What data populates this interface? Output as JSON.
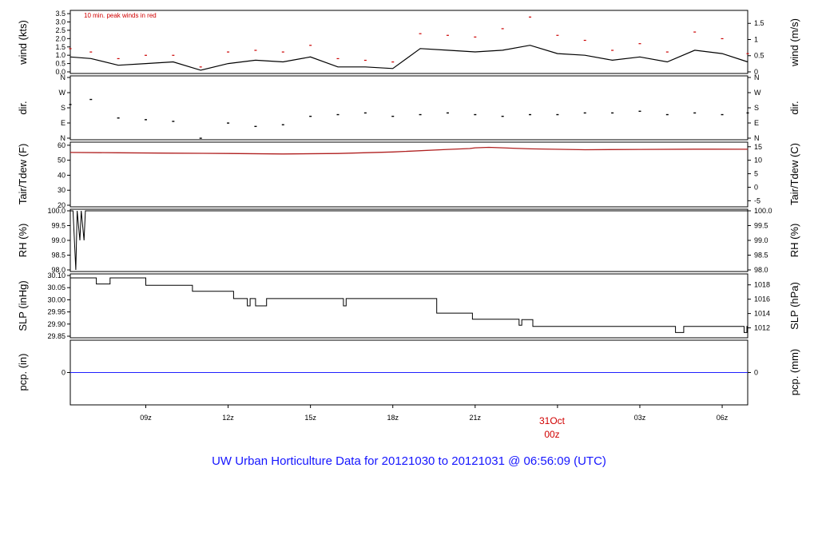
{
  "title": "UW Urban Horticulture Data for 20121030  to  20121031 @ 06:56:09  (UTC)",
  "date_marker": {
    "day": "31Oct",
    "hour": "00z"
  },
  "x_ticks": [
    "09z",
    "12z",
    "15z",
    "18z",
    "21z",
    "03z",
    "06z"
  ],
  "colors": {
    "line": "#000000",
    "peak": "#cc0000",
    "temperature": "#b02020",
    "precip": "#2020ff",
    "title": "#1515ff",
    "date": "#d00000"
  },
  "chart_data": [
    {
      "type": "line",
      "ylabel_left": "wind (kts)",
      "ylabel_right": "wind (m/s)",
      "annotation": "10 min. peak winds in red",
      "ylim": [
        0,
        3.6
      ],
      "left_ticks": [
        "0.0",
        "0.5",
        "1.0",
        "1.5",
        "2.0",
        "2.5",
        "3.0",
        "3.5"
      ],
      "right_ticks": [
        "0",
        "0.5",
        "1",
        "1.5"
      ],
      "x_hours": [
        6.25,
        7,
        8,
        9,
        10,
        11,
        12,
        13,
        14,
        15,
        16,
        17,
        18,
        19,
        20,
        21,
        22,
        23,
        24,
        25,
        26,
        27,
        28,
        29,
        30,
        30.93
      ],
      "speed": [
        0.9,
        0.8,
        0.4,
        0.5,
        0.6,
        0.1,
        0.5,
        0.7,
        0.6,
        0.9,
        0.3,
        0.3,
        0.2,
        1.4,
        1.3,
        1.2,
        1.3,
        1.6,
        1.1,
        1.0,
        0.7,
        0.9,
        0.6,
        1.3,
        1.1,
        0.6
      ],
      "peak": [
        1.4,
        1.2,
        0.8,
        1.0,
        1.0,
        0.3,
        1.2,
        1.3,
        1.2,
        1.6,
        0.8,
        0.7,
        0.6,
        2.3,
        2.2,
        2.1,
        2.6,
        3.3,
        2.2,
        1.9,
        1.3,
        1.7,
        1.2,
        2.4,
        2.0,
        1.1
      ]
    },
    {
      "type": "scatter",
      "ylabel_left": "dir.",
      "ylabel_right": "dir.",
      "compass_ticks": [
        "N",
        "E",
        "S",
        "W",
        "N"
      ],
      "ylim": [
        0,
        360
      ],
      "x_hours": [
        6.25,
        7,
        8,
        9,
        10,
        11,
        12,
        13,
        14,
        15,
        16,
        17,
        18,
        19,
        20,
        21,
        22,
        23,
        24,
        25,
        26,
        27,
        28,
        29,
        30,
        30.93
      ],
      "direction_deg": [
        200,
        230,
        120,
        110,
        100,
        0,
        90,
        70,
        80,
        130,
        140,
        150,
        130,
        140,
        150,
        140,
        130,
        140,
        140,
        150,
        150,
        160,
        140,
        150,
        140,
        150
      ]
    },
    {
      "type": "line",
      "ylabel_left": "Tair/Tdew (F)",
      "ylabel_right": "Tair/Tdew (C)",
      "ylim": [
        20,
        61
      ],
      "left_ticks": [
        "20",
        "30",
        "40",
        "50",
        "60"
      ],
      "right_ticks": [
        "-5",
        "0",
        "5",
        "10",
        "15"
      ],
      "x_hours": [
        6.25,
        8,
        10,
        12,
        14,
        16,
        18,
        20,
        20.8,
        21,
        21.5,
        23,
        25,
        27,
        29,
        30.93
      ],
      "tair_f": [
        55.2,
        55.0,
        54.7,
        54.5,
        54.2,
        54.5,
        55.5,
        57.2,
        57.8,
        58.3,
        58.6,
        57.6,
        57.0,
        57.2,
        57.4,
        57.3
      ]
    },
    {
      "type": "line",
      "ylabel_left": "RH (%)",
      "ylabel_right": "RH (%)",
      "ylim": [
        98,
        100
      ],
      "ticks": [
        "98.0",
        "98.5",
        "99.0",
        "99.5",
        "100.0"
      ],
      "x_hours": [
        6.25,
        6.35,
        6.45,
        6.5,
        6.6,
        6.65,
        6.75,
        6.8,
        6.9,
        30.93
      ],
      "rh_pct": [
        100,
        100,
        98,
        100,
        99,
        100,
        99,
        100,
        100,
        100
      ]
    },
    {
      "type": "line",
      "ylabel_left": "SLP (inHg)",
      "ylabel_right": "SLP (hPa)",
      "ylim": [
        29.85,
        30.1
      ],
      "left_ticks": [
        "29.85",
        "29.90",
        "29.95",
        "30.00",
        "30.05",
        "30.10"
      ],
      "right_ticks": [
        "1012",
        "1014",
        "1016",
        "1018"
      ],
      "x_hours": [
        6.25,
        7,
        7.2,
        7.7,
        9,
        10.7,
        12.2,
        12.7,
        12.8,
        13,
        13.4,
        16.2,
        16.3,
        19.6,
        20.9,
        22.6,
        22.7,
        23.1,
        27.6,
        28.3,
        28.6,
        30.8,
        30.9
      ],
      "slp_inhg": [
        30.09,
        30.09,
        30.065,
        30.09,
        30.06,
        30.035,
        30.005,
        29.975,
        30.005,
        29.975,
        30.005,
        29.975,
        30.005,
        29.945,
        29.92,
        29.895,
        29.918,
        29.89,
        29.89,
        29.865,
        29.89,
        29.865,
        29.89
      ]
    },
    {
      "type": "line",
      "ylabel_left": "pcp. (in)",
      "ylabel_right": "pcp. (mm)",
      "ylim": [
        -1,
        1
      ],
      "left_ticks": [
        "0"
      ],
      "right_ticks": [
        "0"
      ],
      "x_hours": [
        6.25,
        30.93
      ],
      "pcp_in": [
        0,
        0
      ]
    }
  ]
}
